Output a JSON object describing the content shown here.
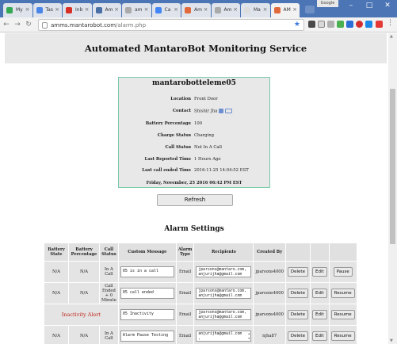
{
  "browser": {
    "tabs": [
      {
        "label": "My",
        "icon": "drive-icon",
        "color": "#34a853"
      },
      {
        "label": "Tas",
        "icon": "docs-icon",
        "color": "#4a86e8"
      },
      {
        "label": "Inb",
        "icon": "gmail-icon",
        "color": "#d93025"
      },
      {
        "label": "Am",
        "icon": "page-icon",
        "color": "#4a6fa5"
      },
      {
        "label": "am",
        "icon": "google-icon",
        "color": "#aaaaaa"
      },
      {
        "label": "Ca",
        "icon": "drive-icon",
        "color": "#4285f4"
      },
      {
        "label": "Am",
        "icon": "mantaro-icon",
        "color": "#e06a3b"
      },
      {
        "label": "Am",
        "icon": "google-icon",
        "color": "#aaaaaa"
      },
      {
        "label": "Ma",
        "icon": "page-icon",
        "color": "#dddddd"
      },
      {
        "label": "AM",
        "icon": "mantaro-icon",
        "color": "#e06a3b",
        "active": true
      }
    ],
    "profile_label": "Google",
    "url_host": "amms.mantarobot.com",
    "url_path": "/alarm.php"
  },
  "banner": {
    "title": "Automated MantaroBot Monitoring Service"
  },
  "device": {
    "name": "mantarobotteleme05",
    "fields": [
      {
        "label": "Location",
        "value": "Front Door"
      },
      {
        "label": "Contact",
        "value": "Shishir Jha"
      },
      {
        "label": "Battery Percentage",
        "value": "100"
      },
      {
        "label": "Charge Status",
        "value": "Charging"
      },
      {
        "label": "Call Status",
        "value": "Not In A Call"
      },
      {
        "label": "Last Reported Time",
        "value": "1 Hours Ago"
      },
      {
        "label": "Last call ended Time",
        "value": "2016-11-25 14:04:52 EST"
      }
    ],
    "current_date": "Friday, November, 25 2016 06:42 PM EST"
  },
  "refresh_label": "Refresh",
  "alarm_settings": {
    "title": "Alarm Settings",
    "headers": [
      "Battery State",
      "Battery Percentage",
      "Call Status",
      "Custom Message",
      "Alarm Type",
      "Recipients",
      "Created By",
      "",
      "",
      ""
    ],
    "rows": [
      {
        "battery_state": "N/A",
        "battery_pct": "N/A",
        "call_status": "In A Call",
        "message": "05 is in a call",
        "alarm_type": "Email",
        "recipients": [
          "jparsons@mantaro.com,",
          "anjurijha@gmail.com"
        ],
        "created_by": "jparsons4000",
        "delete": "Delete",
        "edit": "Edit",
        "toggle": "Pause"
      },
      {
        "battery_state": "N/A",
        "battery_pct": "N/A",
        "call_status": "Call Ended + 0 Minute",
        "message": "05 call ended",
        "alarm_type": "Email",
        "recipients": [
          "jparsons@mantaro.com,",
          "anjurijha@gmail.com"
        ],
        "created_by": "jparsons4000",
        "delete": "Delete",
        "edit": "Edit",
        "toggle": "Resume"
      },
      {
        "inactivity": "Inactivity Alert",
        "message": "05 Inactivity",
        "alarm_type": "Email",
        "recipients": [
          "jparsons@mantaro.com,",
          "anjurijha@gmail.com"
        ],
        "created_by": "jparsons4000",
        "delete": "Delete",
        "edit": "Edit",
        "toggle": "Resume"
      },
      {
        "battery_state": "N/A",
        "battery_pct": "N/A",
        "call_status": "In A Call",
        "message": "Alarm Pause Testing",
        "alarm_type": "Email",
        "recipients": [
          "anjurijha@gmail.com",
          ","
        ],
        "created_by": "njha87",
        "delete": "Delete",
        "edit": "Edit",
        "toggle": "Resume"
      }
    ]
  }
}
